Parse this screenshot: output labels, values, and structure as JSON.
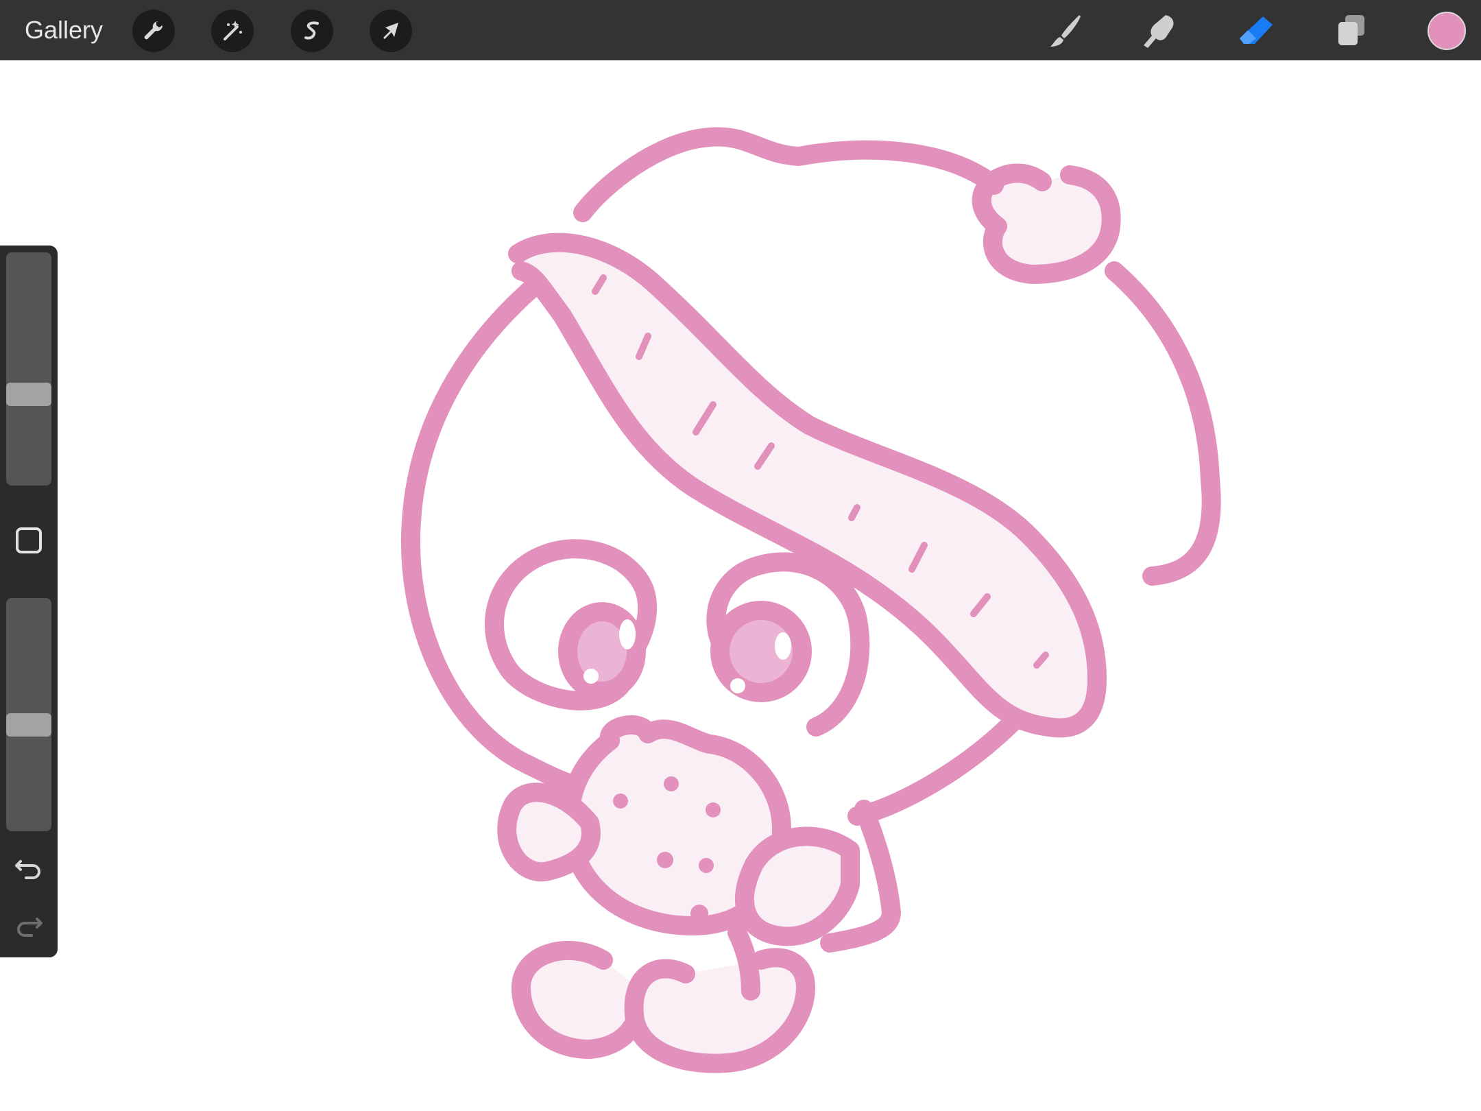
{
  "topbar": {
    "gallery_label": "Gallery",
    "left_tools": [
      {
        "name": "actions-tool",
        "icon": "wrench-icon"
      },
      {
        "name": "adjustments-tool",
        "icon": "magic-wand-icon"
      },
      {
        "name": "selection-tool",
        "icon": "selection-s-icon"
      },
      {
        "name": "transform-tool",
        "icon": "arrow-cursor-icon"
      }
    ],
    "right_tools": [
      {
        "name": "brush-tool",
        "icon": "brush-icon",
        "active": false
      },
      {
        "name": "smudge-tool",
        "icon": "smudge-finger-icon",
        "active": false
      },
      {
        "name": "eraser-tool",
        "icon": "eraser-icon",
        "active": true
      },
      {
        "name": "layers-button",
        "icon": "layers-icon",
        "active": false
      }
    ],
    "current_color": "#e290bc"
  },
  "sidebar": {
    "brush_size_level": 0.38,
    "opacity_level": 0.45,
    "undo_icon": "undo-icon",
    "redo_icon": "redo-icon",
    "modify_icon": "square-icon"
  },
  "colors": {
    "toolbar_bg": "#333333",
    "sidebar_bg": "#2b2b2b",
    "active_tool": "#1a7cf5",
    "stroke_pink": "#e290bc",
    "fill_pink": "#fbeff6",
    "iris_pink": "#ecb4d4"
  }
}
